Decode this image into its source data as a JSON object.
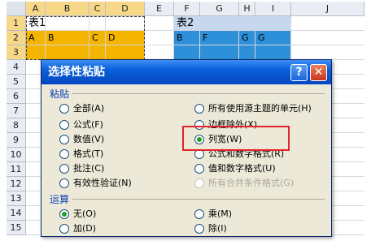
{
  "spreadsheet": {
    "columns": [
      "A",
      "B",
      "C",
      "D",
      "E",
      "F",
      "G",
      "H",
      "I",
      "J"
    ],
    "rows": [
      "1",
      "2",
      "3",
      "4",
      "5",
      "6",
      "7",
      "8",
      "9",
      "10",
      "11",
      "12",
      "13",
      "14",
      "15"
    ],
    "cells": {
      "A1": "表1",
      "F1": "表2",
      "A2": "A",
      "B2": "B",
      "C2": "C",
      "D2": "D",
      "F2": "B",
      "G2": "F",
      "H2": "G",
      "I2": "G"
    },
    "colors": {
      "source_fill": "#f5b400",
      "dest_fill": "#2e90d8",
      "selected_header": "#f7d889"
    }
  },
  "dialog": {
    "title": "选择性粘贴",
    "help_label": "?",
    "close_label": "✕",
    "paste_section": "粘贴",
    "operation_section": "运算",
    "paste_options_left": [
      {
        "label": "全部(A)",
        "checked": false,
        "disabled": false
      },
      {
        "label": "公式(F)",
        "checked": false,
        "disabled": false
      },
      {
        "label": "数值(V)",
        "checked": false,
        "disabled": false
      },
      {
        "label": "格式(T)",
        "checked": false,
        "disabled": false
      },
      {
        "label": "批注(C)",
        "checked": false,
        "disabled": false
      },
      {
        "label": "有效性验证(N)",
        "checked": false,
        "disabled": false
      }
    ],
    "paste_options_right": [
      {
        "label": "所有使用源主题的单元(H)",
        "checked": false,
        "disabled": false
      },
      {
        "label": "边框除外(X)",
        "checked": false,
        "disabled": false
      },
      {
        "label": "列宽(W)",
        "checked": true,
        "disabled": false
      },
      {
        "label": "公式和数字格式(R)",
        "checked": false,
        "disabled": false
      },
      {
        "label": "值和数字格式(U)",
        "checked": false,
        "disabled": false
      },
      {
        "label": "所有合并条件格式(G)",
        "checked": false,
        "disabled": true
      }
    ],
    "operation_options_left": [
      {
        "label": "无(O)",
        "checked": true
      },
      {
        "label": "加(D)",
        "checked": false
      }
    ],
    "operation_options_right": [
      {
        "label": "乘(M)",
        "checked": false
      },
      {
        "label": "除(I)",
        "checked": false
      }
    ],
    "colors": {
      "title_bar": "#0a5fd8",
      "dialog_bg": "#ece9d8",
      "section_text": "#0a3fb5",
      "highlight_border": "#e2232a"
    }
  }
}
